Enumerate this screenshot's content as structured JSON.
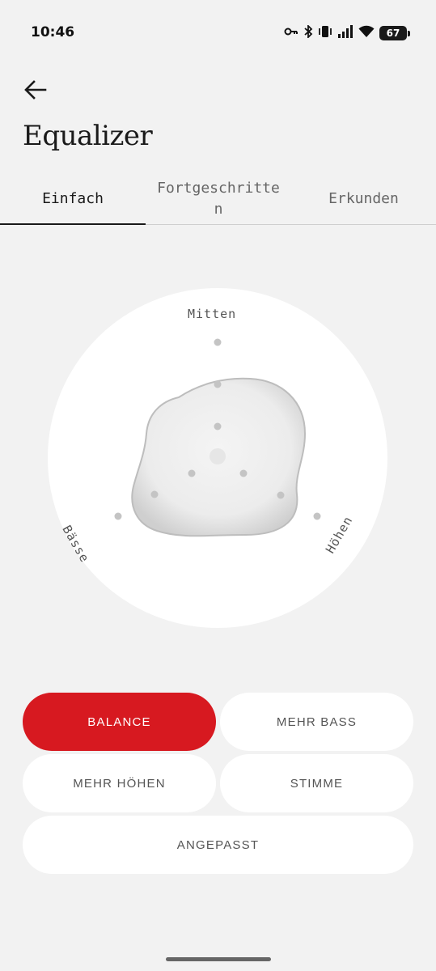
{
  "status_bar": {
    "time": "10:46",
    "icons": [
      "key-icon",
      "bluetooth-icon",
      "vibrate-icon",
      "signal-icon",
      "wifi-icon"
    ],
    "battery": "67"
  },
  "header": {
    "back_icon": "arrow-left-icon",
    "title": "Equalizer"
  },
  "tabs": [
    {
      "label": "Einfach",
      "active": true
    },
    {
      "label": "Fortgeschritte\nn",
      "active": false
    },
    {
      "label": "Erkunden",
      "active": false
    }
  ],
  "equalizer": {
    "labels": {
      "mid": "Mitten",
      "bass": "Bässe",
      "treble": "Höhen"
    }
  },
  "presets": {
    "balance": "BALANCE",
    "more_bass": "MEHR BASS",
    "more_treble": "MEHR HÖHEN",
    "voice": "STIMME",
    "custom": "ANGEPASST",
    "active": "balance",
    "accent_color": "#d71920"
  }
}
